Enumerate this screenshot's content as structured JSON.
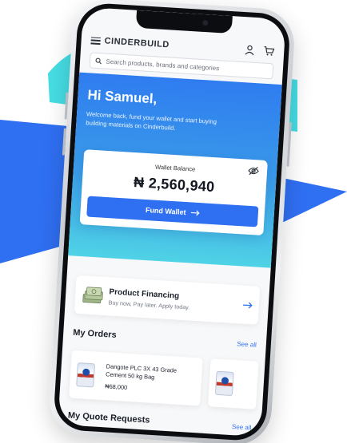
{
  "brand": {
    "name": "CINDERBUILD",
    "accent": "#2f6ff2",
    "hero_gradient": [
      "#2f7cf0",
      "#4fd3e6"
    ]
  },
  "header": {
    "menu_icon": "hamburger-icon",
    "account_icon": "user-icon",
    "cart_icon": "cart-icon"
  },
  "search": {
    "placeholder": "Search products, brands and categories",
    "icon": "search-icon"
  },
  "hero": {
    "greeting": "Hi Samuel,",
    "subtitle": "Welcome back, fund your wallet and start buying building materials on Cinderbuild."
  },
  "wallet": {
    "label": "Wallet Balance",
    "amount": "₦ 2,560,940",
    "visibility_icon": "eye-off-icon",
    "fund_button": "Fund Wallet",
    "fund_icon": "arrow-right-icon"
  },
  "financing": {
    "title": "Product Financing",
    "subtitle": "Buy now, Pay later. Apply today.",
    "icon": "money-stack-icon",
    "arrow_icon": "arrow-right-icon"
  },
  "orders": {
    "title": "My Orders",
    "see_all": "See all",
    "items": [
      {
        "name": "Dangote PLC 3X 43 Grade Cement 50 kg Bag",
        "price": "₦68,000"
      }
    ]
  },
  "quotes": {
    "title": "My Quote Requests",
    "see_all": "See all"
  }
}
